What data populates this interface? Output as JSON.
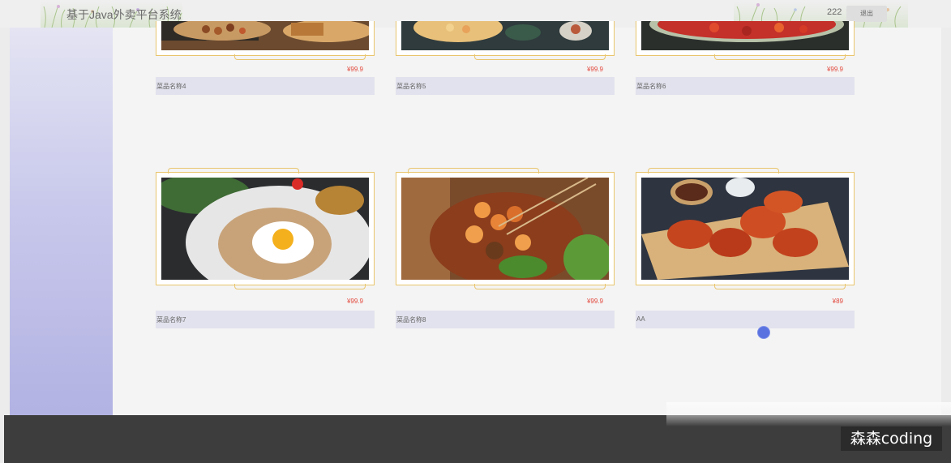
{
  "header": {
    "title": "基于Java外卖平台系统",
    "username": "222",
    "logout_label": "退出"
  },
  "dishes": [
    {
      "name": "菜品名称4",
      "price": "¥99.9",
      "image": "mixed-grill-photo"
    },
    {
      "name": "菜品名称5",
      "price": "¥99.9",
      "image": "seafood-pasta-photo"
    },
    {
      "name": "菜品名称6",
      "price": "¥99.9",
      "image": "spicy-crayfish-photo"
    },
    {
      "name": "菜品名称7",
      "price": "¥99.9",
      "image": "egg-fried-rice-photo"
    },
    {
      "name": "菜品名称8",
      "price": "¥99.9",
      "image": "shrimp-skewers-photo"
    },
    {
      "name": "AA",
      "price": "¥89",
      "image": "chicken-wings-photo"
    }
  ],
  "watermark": "森森coding",
  "colors": {
    "accent_gold": "#e9c56d",
    "price_red": "#e2473b",
    "sidebar_purple": "#b2b2e3",
    "bottom_bar": "#3d3d3d"
  }
}
